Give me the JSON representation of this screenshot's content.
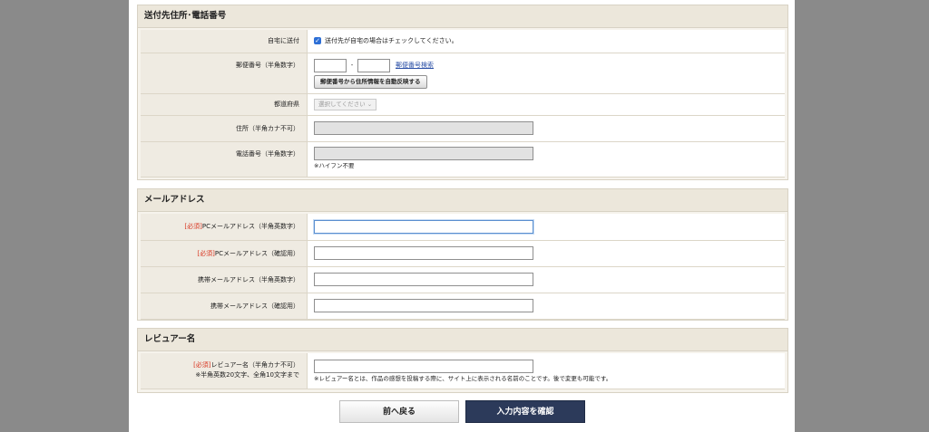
{
  "shipping": {
    "title": "送付先住所･電話番号",
    "home_label": "自宅に送付",
    "home_checkbox_text": "送付先が自宅の場合はチェックしてください。",
    "postal_label": "郵便番号（半角数字）",
    "postal_dash": "-",
    "postal_search_link": "郵便番号検索",
    "postal_auto_button": "郵便番号から住所情報を自動反映する",
    "prefecture_label": "都道府県",
    "prefecture_value": "選択してください",
    "address_label": "住所（半角カナ不可）",
    "phone_label": "電話番号（半角数字）",
    "phone_note": "※ハイフン不要"
  },
  "email": {
    "title": "メールアドレス",
    "required_tag": "[必須]",
    "pc_label": "PCメールアドレス（半角英数字）",
    "pc_confirm_label": "PCメールアドレス（確認用）",
    "mobile_label": "携帯メールアドレス（半角英数字）",
    "mobile_confirm_label": "携帯メールアドレス（確認用）"
  },
  "reviewer": {
    "title": "レビュアー名",
    "required_tag": "[必須]",
    "label": "レビュアー名（半角カナ不可）",
    "label_note": "※半角英数20文字、全角10文字まで",
    "note": "※レビュアー名とは、作品の感想を投稿する際に、サイト上に表示される名前のことです。後で変更も可能です。"
  },
  "buttons": {
    "back": "前へ戻る",
    "confirm": "入力内容を確認"
  }
}
